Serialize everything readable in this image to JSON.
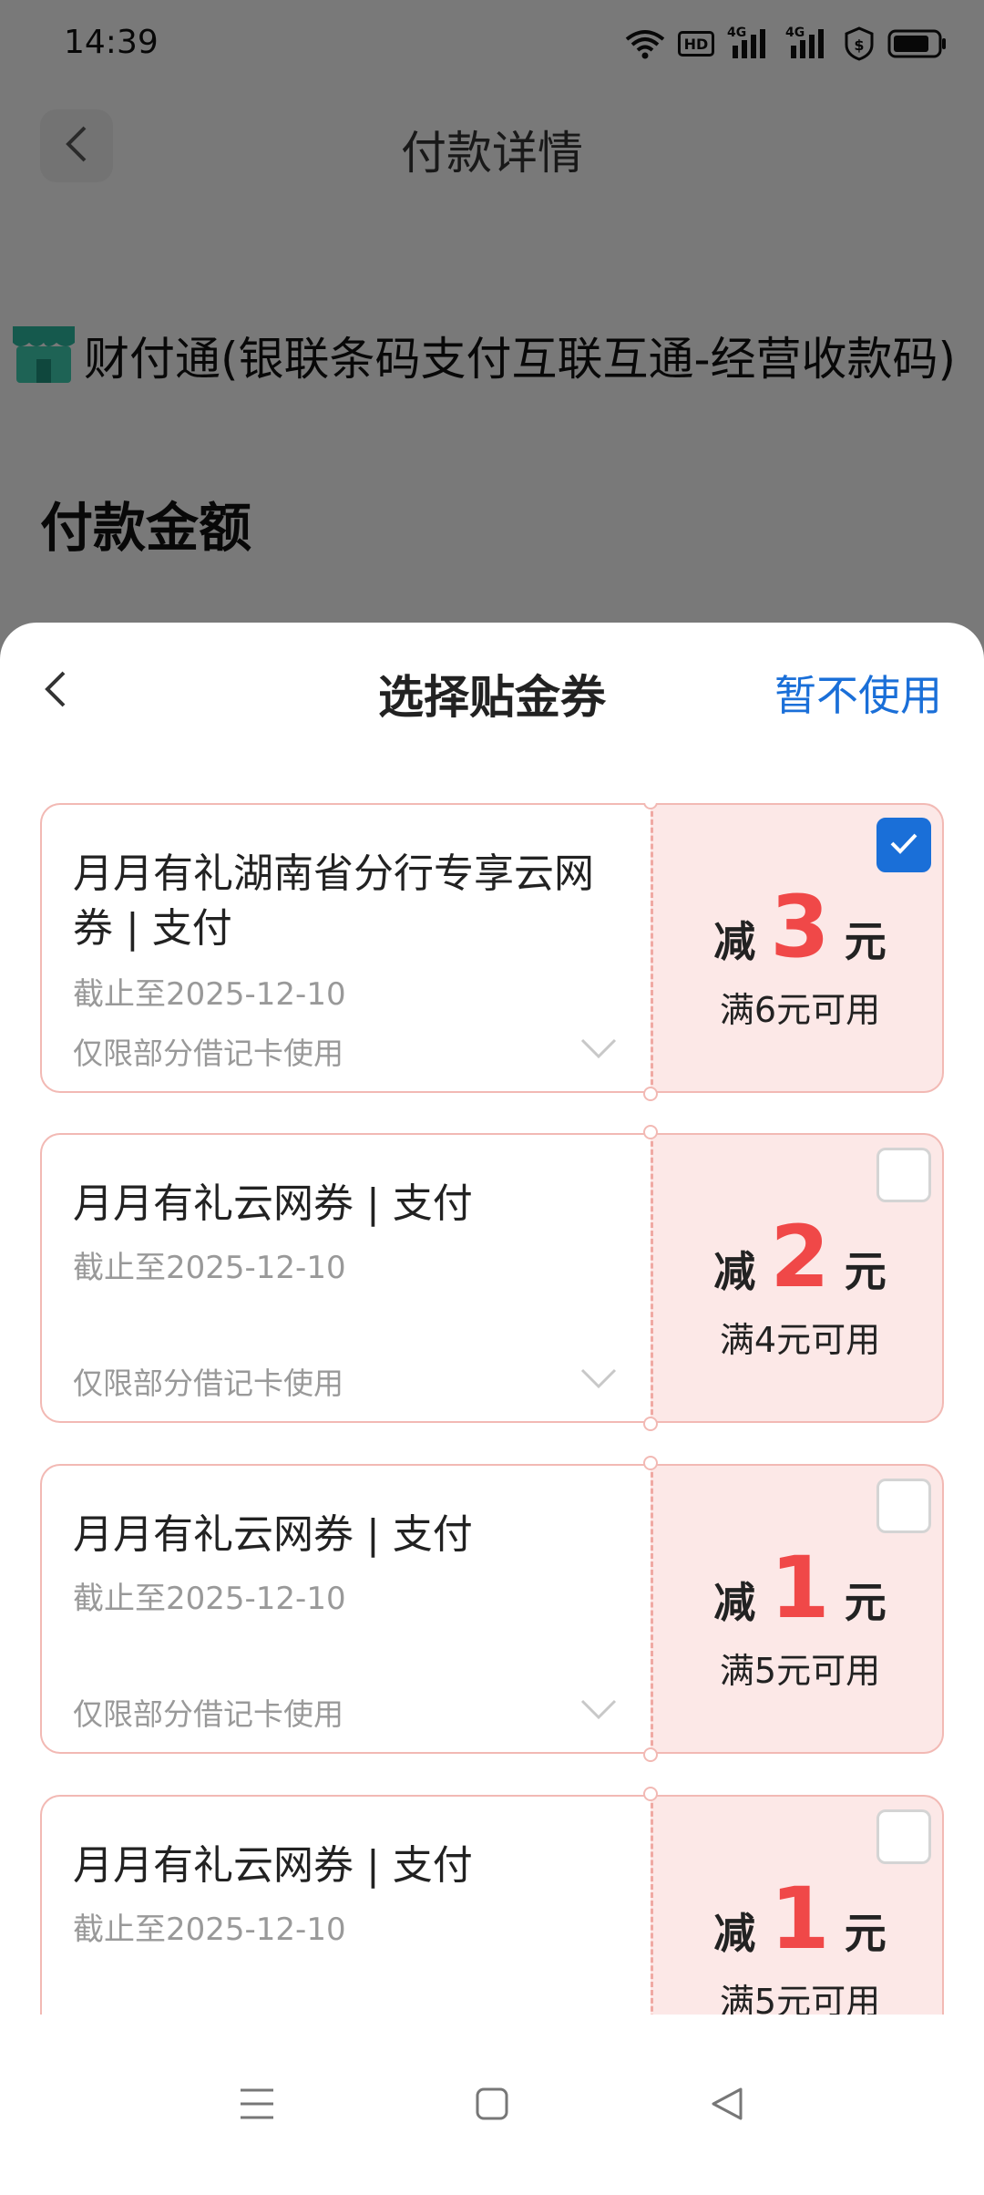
{
  "status_bar": {
    "time": "14:39",
    "icons": [
      "wifi-icon",
      "hd-icon",
      "signal-4g-icon",
      "signal-4g-icon",
      "shield-icon",
      "battery-icon"
    ],
    "hd_label": "HD",
    "net_label": "4G"
  },
  "background_page": {
    "title": "付款详情",
    "merchant": "财付通(银联条码支付互联互通-经营收款码)",
    "amount_label": "付款金额"
  },
  "sheet": {
    "title": "选择贴金券",
    "skip_label": "暂不使用"
  },
  "coupons": [
    {
      "title": "月月有礼湖南省分行专享云网券 | 支付",
      "expire": "截止至2025-12-10",
      "restriction": "仅限部分借记卡使用",
      "prefix": "减",
      "value": "3",
      "unit": "元",
      "condition": "满6元可用",
      "selected": true
    },
    {
      "title": "月月有礼云网券 | 支付",
      "expire": "截止至2025-12-10",
      "restriction": "仅限部分借记卡使用",
      "prefix": "减",
      "value": "2",
      "unit": "元",
      "condition": "满4元可用",
      "selected": false
    },
    {
      "title": "月月有礼云网券 | 支付",
      "expire": "截止至2025-12-10",
      "restriction": "仅限部分借记卡使用",
      "prefix": "减",
      "value": "1",
      "unit": "元",
      "condition": "满5元可用",
      "selected": false
    },
    {
      "title": "月月有礼云网券 | 支付",
      "expire": "截止至2025-12-10",
      "restriction": "",
      "prefix": "减",
      "value": "1",
      "unit": "元",
      "condition": "满5元可用",
      "selected": false
    }
  ],
  "colors": {
    "accent": "#1a6fd8",
    "discount_red": "#f04848",
    "coupon_bg": "#fce8e7",
    "coupon_border": "#f2b9b4"
  },
  "nav_bar": {
    "icons": [
      "menu-icon",
      "home-square-icon",
      "back-triangle-icon"
    ]
  }
}
